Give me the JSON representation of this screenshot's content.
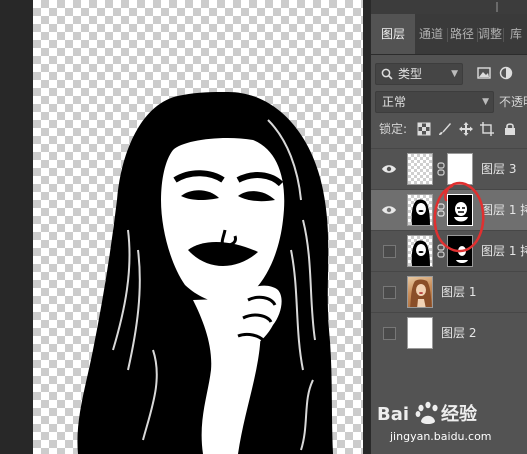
{
  "canvas": {
    "description_icon": "document-canvas"
  },
  "tabs": [
    {
      "label": "图层",
      "active": true
    },
    {
      "label": "通道",
      "active": false
    },
    {
      "label": "路径",
      "active": false
    },
    {
      "label": "调整",
      "active": false
    },
    {
      "label": "库",
      "active": false
    }
  ],
  "filter": {
    "kind_label": "类型",
    "icons": [
      "image-filter-icon",
      "adjustment-filter-icon"
    ]
  },
  "blend": {
    "mode": "正常",
    "opacity_label": "不透明"
  },
  "lock": {
    "label": "锁定:",
    "icons": [
      "lock-transparent-icon",
      "lock-paint-icon",
      "lock-position-icon",
      "lock-artboard-icon",
      "lock-all-icon"
    ]
  },
  "layers": [
    {
      "name": "图层 3",
      "visible": true,
      "thumb": "check",
      "mask": "white",
      "linked": true,
      "selected": false
    },
    {
      "name": "图层 1 拷",
      "visible": true,
      "thumb": "portrait",
      "mask": "portrait-inverted",
      "linked": true,
      "selected": true
    },
    {
      "name": "图层 1 拷",
      "visible": false,
      "thumb": "portrait",
      "mask": "portrait-dark",
      "linked": true,
      "selected": false
    },
    {
      "name": "图层 1",
      "visible": false,
      "thumb": "photo",
      "mask": null,
      "linked": false,
      "selected": false
    },
    {
      "name": "图层 2",
      "visible": false,
      "thumb": "white",
      "mask": null,
      "linked": false,
      "selected": false
    }
  ],
  "watermark": {
    "brand": "Bai 经验",
    "url": "jingyan.baidu.com"
  },
  "colors": {
    "panel": "#535353",
    "selected_row": "#6f6f6f",
    "annotation": "#e03030"
  }
}
